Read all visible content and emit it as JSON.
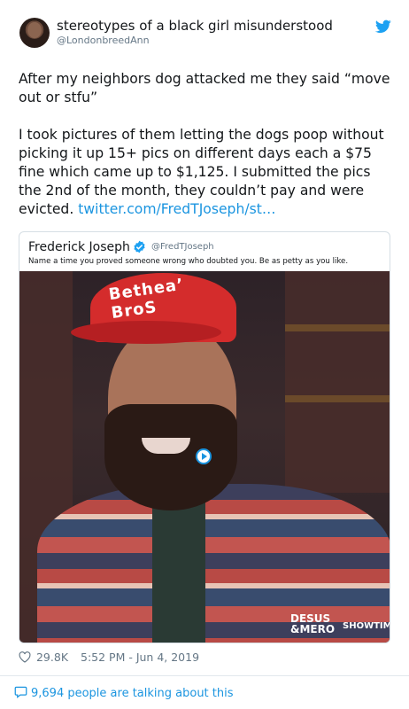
{
  "tweet": {
    "author": {
      "display_name": "stereotypes of a black girl misunderstood",
      "handle": "@LondonbreedAnn"
    },
    "text_paragraph_1": "After my neighbors dog attacked me they said “move out or stfu”",
    "text_paragraph_2": "I took pictures of them letting the dogs poop without picking it up 15+ pics on different days each a $75 fine which came up to $1,125. I submitted the pics the 2nd of the month, they couldn’t pay and were evicted.",
    "link": "twitter.com/FredTJoseph/st…",
    "likes": "29.8K",
    "timestamp": "5:52 PM - Jun 4, 2019",
    "talking": "9,694 people are talking about this"
  },
  "quote": {
    "author_name": "Frederick Joseph",
    "author_handle": "@FredTJoseph",
    "text": "Name a time you proved someone wrong who doubted you. Be as petty as you like.",
    "media": {
      "cap_logo": "Bethea’ BroS",
      "watermark_left": "DESUS\n&MERO",
      "watermark_right": "SHOWTIME"
    }
  },
  "icons": {
    "twitter_bird": "twitter-bird-icon",
    "verified": "verified-badge-icon",
    "heart": "heart-icon",
    "comment": "comment-bubble-icon",
    "play": "play-icon"
  },
  "colors": {
    "link": "#1b95e0",
    "secondary_text": "#657786",
    "primary_text": "#14171a"
  }
}
